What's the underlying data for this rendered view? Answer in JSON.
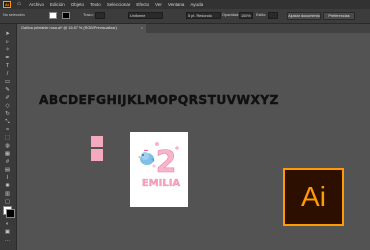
{
  "menubar": {
    "app_logo": "Ai",
    "items": [
      "Archivo",
      "Edición",
      "Objeto",
      "Texto",
      "Seleccionar",
      "Efecto",
      "Ver",
      "Ventana",
      "Ayuda"
    ]
  },
  "controlbar": {
    "selection_status": "No selección",
    "stroke_label": "Trazo:",
    "brush_label": "Uniforme",
    "brush_size": "5 pt. Redondo",
    "opacity_label": "Opacidad:",
    "opacity_value": "100%",
    "style_label": "Estilo:",
    "arrange_doc_button": "Ajustar documento",
    "preferences_button": "Preferencias",
    "fill_color": "#ffffff",
    "stroke_color": "#000000"
  },
  "document_tab": {
    "title": "Gallina printable rosa.ai* @ 16.67 % (RGB/Previsualizar)",
    "close": "×"
  },
  "canvas": {
    "alphabet": "ABCDEFGHIJKLMOPQRSTUVWXYZ",
    "artboard_digit": "2",
    "artboard_name": "EMILIA",
    "pink_color": "#f5a9bf"
  },
  "tools": [
    "selection-tool",
    "direct-selection-tool",
    "magic-wand-tool",
    "pen-tool",
    "text-tool",
    "line-tool",
    "rectangle-tool",
    "paintbrush-tool",
    "pencil-tool",
    "eraser-tool",
    "rotate-tool",
    "scale-tool",
    "width-tool",
    "free-transform-tool",
    "shape-builder-tool",
    "perspective-grid-tool",
    "mesh-tool",
    "gradient-tool",
    "eyedropper-tool",
    "blend-tool",
    "symbol-sprayer-tool",
    "column-graph-tool",
    "artboard-tool",
    "slice-tool",
    "hand-tool",
    "zoom-tool"
  ],
  "ai_logo": {
    "label": "Ai",
    "accent": "#ff9a00"
  }
}
